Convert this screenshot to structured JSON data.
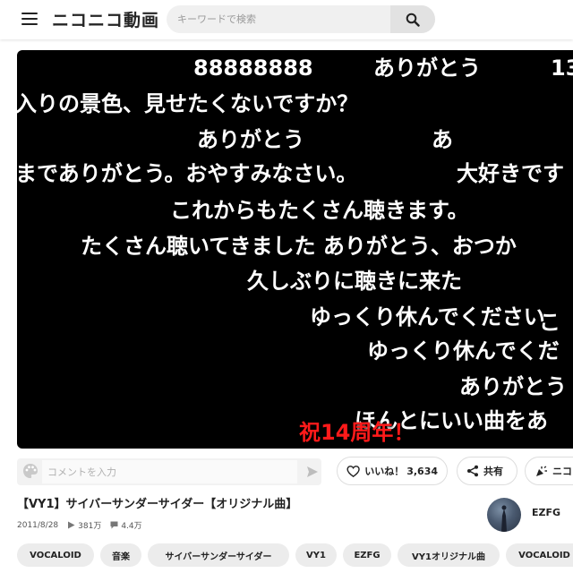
{
  "header": {
    "logo": "ニコニコ動画",
    "search_placeholder": "キーワードで検索"
  },
  "player": {
    "comments": [
      {
        "text": "88888888",
        "color": "#ffffff"
      },
      {
        "text": "ありがとう",
        "color": "#ffffff"
      },
      {
        "text": "13",
        "color": "#ffffff"
      },
      {
        "text": "入りの景色、見せたくないですか？",
        "color": "#ffffff"
      },
      {
        "text": "ありがとう",
        "color": "#ffffff"
      },
      {
        "text": "あ",
        "color": "#ffffff"
      },
      {
        "text": "までありがとう。おやすみなさい。",
        "color": "#ffffff"
      },
      {
        "text": "大好きです",
        "color": "#ffffff"
      },
      {
        "text": "これからもたくさん聴きます。",
        "color": "#ffffff"
      },
      {
        "text": "たくさん聴いてきました ありがとう、おつか",
        "color": "#ffffff"
      },
      {
        "text": "久しぶりに聴きに来た",
        "color": "#ffffff"
      },
      {
        "text": "ゆっくり休んでください",
        "color": "#ffffff"
      },
      {
        "text": "こ",
        "color": "#ffffff"
      },
      {
        "text": "ゆっくり休んでくだ",
        "color": "#ffffff"
      },
      {
        "text": "ありがとう",
        "color": "#ffffff"
      },
      {
        "text": "ほんとにいい曲をあ",
        "color": "#ffffff"
      },
      {
        "text": "祝14周年！",
        "color": "#ff1a1a"
      }
    ]
  },
  "comment_bar": {
    "placeholder": "コメントを入力"
  },
  "actions": {
    "like_label": "いいね！",
    "like_count": "3,634",
    "share_label": "共有",
    "nicoad_label": "ニコ"
  },
  "video": {
    "title": "【VY1】サイバーサンダーサイダー【オリジナル曲】",
    "date": "2011/8/28",
    "views": "381万",
    "comments": "4.4万"
  },
  "uploader": {
    "name": "EZFG"
  },
  "tags": [
    "VOCALOID",
    "音楽",
    "サイバーサンダーサイダー",
    "VY1",
    "EZFG",
    "VY1オリジナル曲",
    "VOCALOID"
  ],
  "colors": {
    "player_bg": "#000000",
    "comment_red": "#ff1a1a",
    "tag_bg": "#ececec"
  }
}
